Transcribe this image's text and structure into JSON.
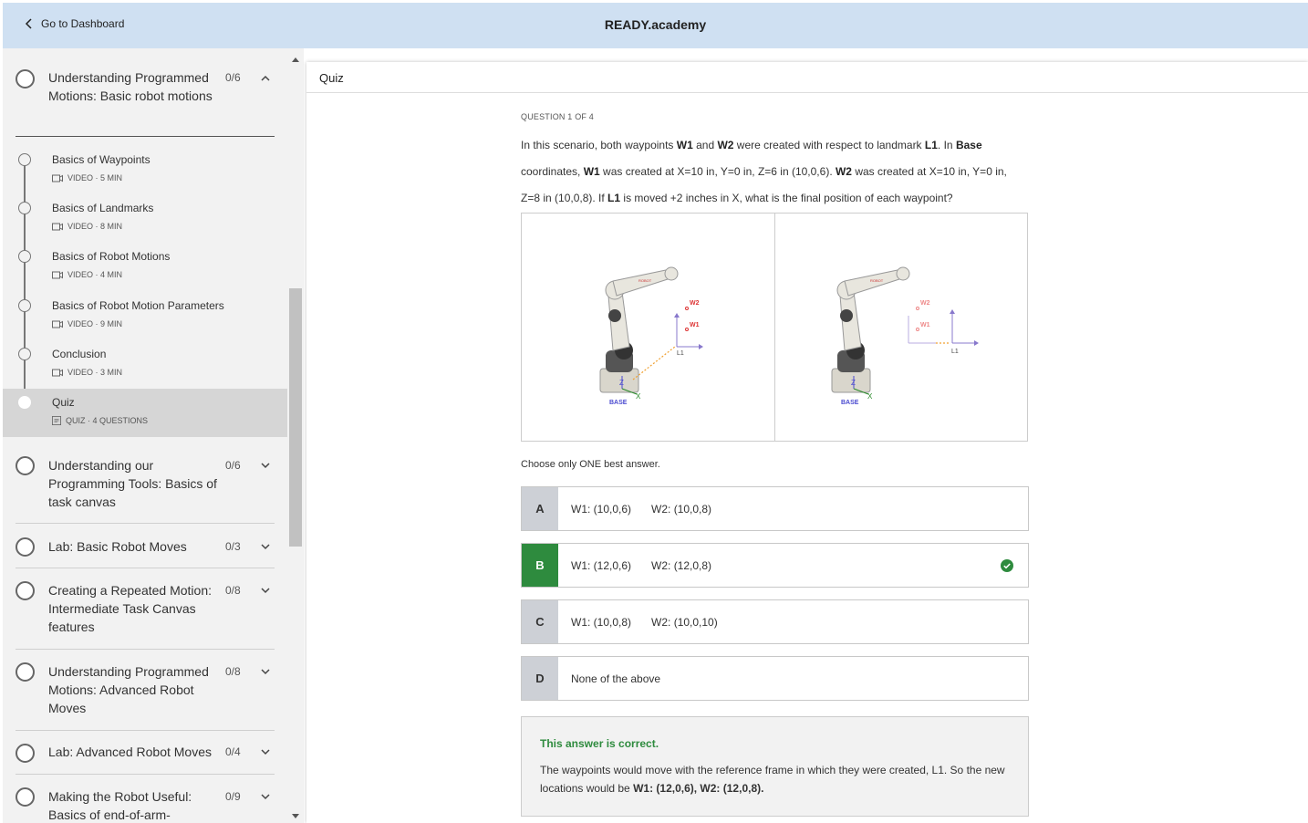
{
  "topbar": {
    "back_label": "Go to Dashboard",
    "brand": "READY.academy"
  },
  "sidebar": {
    "current_module": {
      "title": "Understanding Programmed Motions: Basic robot motions",
      "count": "0/6"
    },
    "lessons": [
      {
        "name": "Basics of Waypoints",
        "meta": "VIDEO · 5 MIN",
        "type": "video"
      },
      {
        "name": "Basics of Landmarks",
        "meta": "VIDEO · 8 MIN",
        "type": "video"
      },
      {
        "name": "Basics of Robot Motions",
        "meta": "VIDEO · 4 MIN",
        "type": "video"
      },
      {
        "name": "Basics of Robot Motion Parameters",
        "meta": "VIDEO · 9 MIN",
        "type": "video"
      },
      {
        "name": "Conclusion",
        "meta": "VIDEO · 3 MIN",
        "type": "video"
      },
      {
        "name": "Quiz",
        "meta": "QUIZ · 4 QUESTIONS",
        "type": "quiz",
        "active": true
      }
    ],
    "modules": [
      {
        "title": "Understanding our Programming Tools: Basics of task canvas",
        "count": "0/6"
      },
      {
        "title": "Lab: Basic Robot Moves",
        "count": "0/3"
      },
      {
        "title": "Creating a Repeated Motion: Intermediate Task Canvas features",
        "count": "0/8"
      },
      {
        "title": "Understanding Programmed Motions: Advanced Robot Moves",
        "count": "0/8"
      },
      {
        "title": "Lab: Advanced Robot Moves",
        "count": "0/4"
      },
      {
        "title": "Making the Robot Useful: Basics of end-of-arm-",
        "count": "0/9"
      }
    ]
  },
  "main": {
    "header_title": "Quiz",
    "question_number": "QUESTION 1 OF 4",
    "question": {
      "p1": "In this scenario, both waypoints ",
      "w1": "W1",
      "p2": " and ",
      "w2": "W2",
      "p3": " were created with respect to landmark ",
      "l1": "L1",
      "p4": ". In ",
      "base": "Base",
      "p5": " coordinates, ",
      "w1b": "W1",
      "p6": " was created at X=10 in, Y=0 in, Z=6 in (10,0,6). ",
      "w2b": "W2",
      "p7": " was created at X=10 in, Y=0 in, Z=8 in (10,0,8). If ",
      "l1b": "L1",
      "p8": " is moved +2 inches in X, what is the final position of each waypoint?"
    },
    "diagram_labels": {
      "w1": "W1",
      "w2": "W2",
      "l1": "L1",
      "base": "BASE",
      "x": "X",
      "z": "Z"
    },
    "hint": "Choose only ONE best answer.",
    "options": [
      {
        "letter": "A",
        "w1": "W1: (10,0,6)",
        "w2": "W2: (10,0,8)"
      },
      {
        "letter": "B",
        "w1": "W1: (12,0,6)",
        "w2": "W2: (12,0,8)",
        "correct": true
      },
      {
        "letter": "C",
        "w1": "W1: (10,0,8)",
        "w2": "W2: (10,0,10)"
      },
      {
        "letter": "D",
        "w1": "None of the above",
        "w2": ""
      }
    ],
    "feedback": {
      "heading": "This answer is correct.",
      "body": "The waypoints would move with the reference frame in which they were created, L1. So the new locations would be ",
      "answer": "W1: (12,0,6), W2: (12,0,8)."
    }
  },
  "colors": {
    "topbar": "#cfe0f2",
    "correct": "#2e8b3e",
    "sidebar_bg": "#f2f2f2",
    "active_lesson": "#d6d6d6"
  }
}
